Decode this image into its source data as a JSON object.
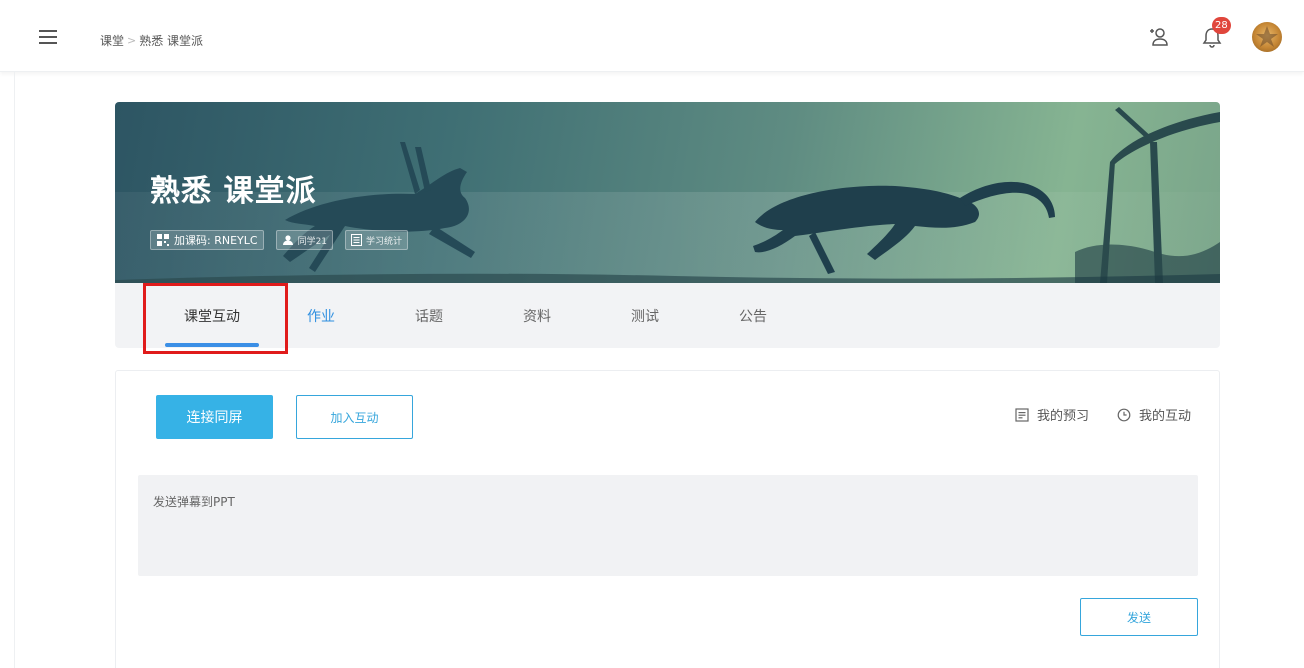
{
  "header": {
    "breadcrumb": [
      "课堂",
      "熟悉 课堂派"
    ],
    "breadcrumb_separator": ">",
    "notification_count": "28",
    "icons": [
      "menu-icon",
      "add-user-icon",
      "bell-icon",
      "avatar"
    ]
  },
  "course": {
    "title": "熟悉 课堂派",
    "code_label": "加课码: RNEYLC",
    "students_label": "同学21",
    "stats_label": "学习统计"
  },
  "tabs": [
    {
      "label": "课堂互动",
      "active": true
    },
    {
      "label": "作业",
      "active": false
    },
    {
      "label": "话题",
      "active": false
    },
    {
      "label": "资料",
      "active": false
    },
    {
      "label": "测试",
      "active": false
    },
    {
      "label": "公告",
      "active": false
    }
  ],
  "interaction": {
    "connect_label": "连接同屏",
    "join_label": "加入互动",
    "my_preview_label": "我的预习",
    "my_interaction_label": "我的互动",
    "danmu_placeholder": "发送弹幕到PPT",
    "send_label": "发送"
  },
  "colors": {
    "accent": "#36b2e6",
    "tab_underline": "#3b8fe6",
    "highlight": "#e01b1b",
    "badge": "#e0463c"
  }
}
